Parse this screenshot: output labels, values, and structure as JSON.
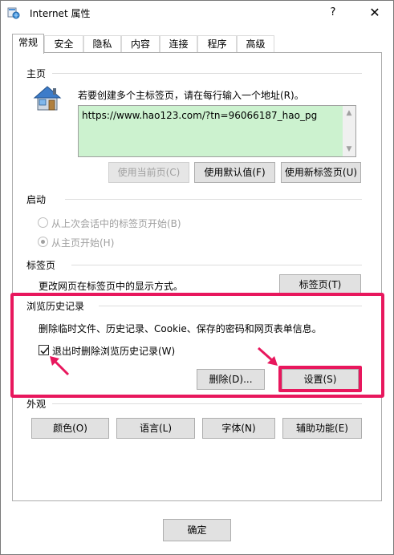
{
  "window": {
    "title": "Internet 属性",
    "help": "?",
    "close": "✕"
  },
  "tabs": [
    "常规",
    "安全",
    "隐私",
    "内容",
    "连接",
    "程序",
    "高级"
  ],
  "homepage": {
    "group_label": "主页",
    "instruction": "若要创建多个主标签页，请在每行输入一个地址(R)。",
    "url": "https://www.hao123.com/?tn=96066187_hao_pg",
    "buttons": {
      "use_current": "使用当前页(C)",
      "use_default": "使用默认值(F)",
      "use_new_tab": "使用新标签页(U)"
    }
  },
  "startup": {
    "group_label": "启动",
    "option1": "从上次会话中的标签页开始(B)",
    "option2": "从主页开始(H)"
  },
  "tabs_section": {
    "group_label": "标签页",
    "description": "更改网页在标签页中的显示方式。",
    "button": "标签页(T)"
  },
  "history": {
    "group_label": "浏览历史记录",
    "description": "删除临时文件、历史记录、Cookie、保存的密码和网页表单信息。",
    "checkbox_label": "退出时删除浏览历史记录(W)",
    "checkbox_checked": true,
    "delete_button": "删除(D)...",
    "settings_button": "设置(S)"
  },
  "appearance": {
    "group_label": "外观",
    "buttons": {
      "colors": "颜色(O)",
      "languages": "语言(L)",
      "fonts": "字体(N)",
      "accessibility": "辅助功能(E)"
    }
  },
  "footer": {
    "ok": "确定"
  },
  "colors": {
    "highlight": "#e8175d",
    "url_background": "#ccf2cf"
  }
}
